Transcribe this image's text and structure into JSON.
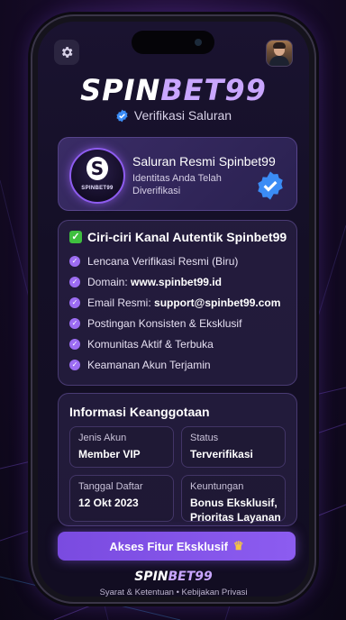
{
  "header": {
    "settings_icon": "gear-icon",
    "avatar": "user-avatar"
  },
  "brand": {
    "part1": "SPIN",
    "part2": "BET99"
  },
  "verification": {
    "label": "Verifikasi Saluran",
    "icon": "verified-badge-icon"
  },
  "official_card": {
    "logo_text": "S",
    "logo_word": "SPINBET99",
    "title": "Saluran Resmi Spinbet99",
    "subtitle": "Identitas Anda Telah Diverifikasi",
    "badge_icon": "large-verified-check-icon"
  },
  "traits": {
    "title": "Ciri-ciri Kanal Autentik Spinbet99",
    "title_icon": "green-checkbox-icon",
    "items": [
      {
        "label": "Lencana Verifikasi Resmi (Biru)",
        "value": ""
      },
      {
        "label": "Domain: ",
        "value": "www.spinbet99.id"
      },
      {
        "label": "Email Resmi: ",
        "value": "support@spinbet99.com"
      },
      {
        "label": "Postingan Konsisten & Eksklusif",
        "value": ""
      },
      {
        "label": "Komunitas Aktif & Terbuka",
        "value": ""
      },
      {
        "label": "Keamanan Akun Terjamin",
        "value": ""
      }
    ]
  },
  "membership": {
    "title": "Informasi Keanggotaan",
    "fields": [
      {
        "label": "Jenis Akun",
        "value": "Member VIP"
      },
      {
        "label": "Status",
        "value": "Terverifikasi"
      },
      {
        "label": "Tanggal Daftar",
        "value": "12 Okt 2023"
      },
      {
        "label": "Keuntungan",
        "value": "Bonus Eksklusif, Prioritas Layanan"
      }
    ]
  },
  "cta": {
    "label": "Akses Fitur Eksklusif",
    "icon": "crown-icon"
  },
  "footer": {
    "brand1": "SPIN",
    "brand2": "BET99",
    "links": "Syarat & Ketentuan  •  Kebijakan Privasi"
  },
  "colors": {
    "accent": "#8c5cf0",
    "brand_purple": "#c9a6ff",
    "verified_blue": "#3b8cf5",
    "check_green": "#3fbf3f"
  }
}
